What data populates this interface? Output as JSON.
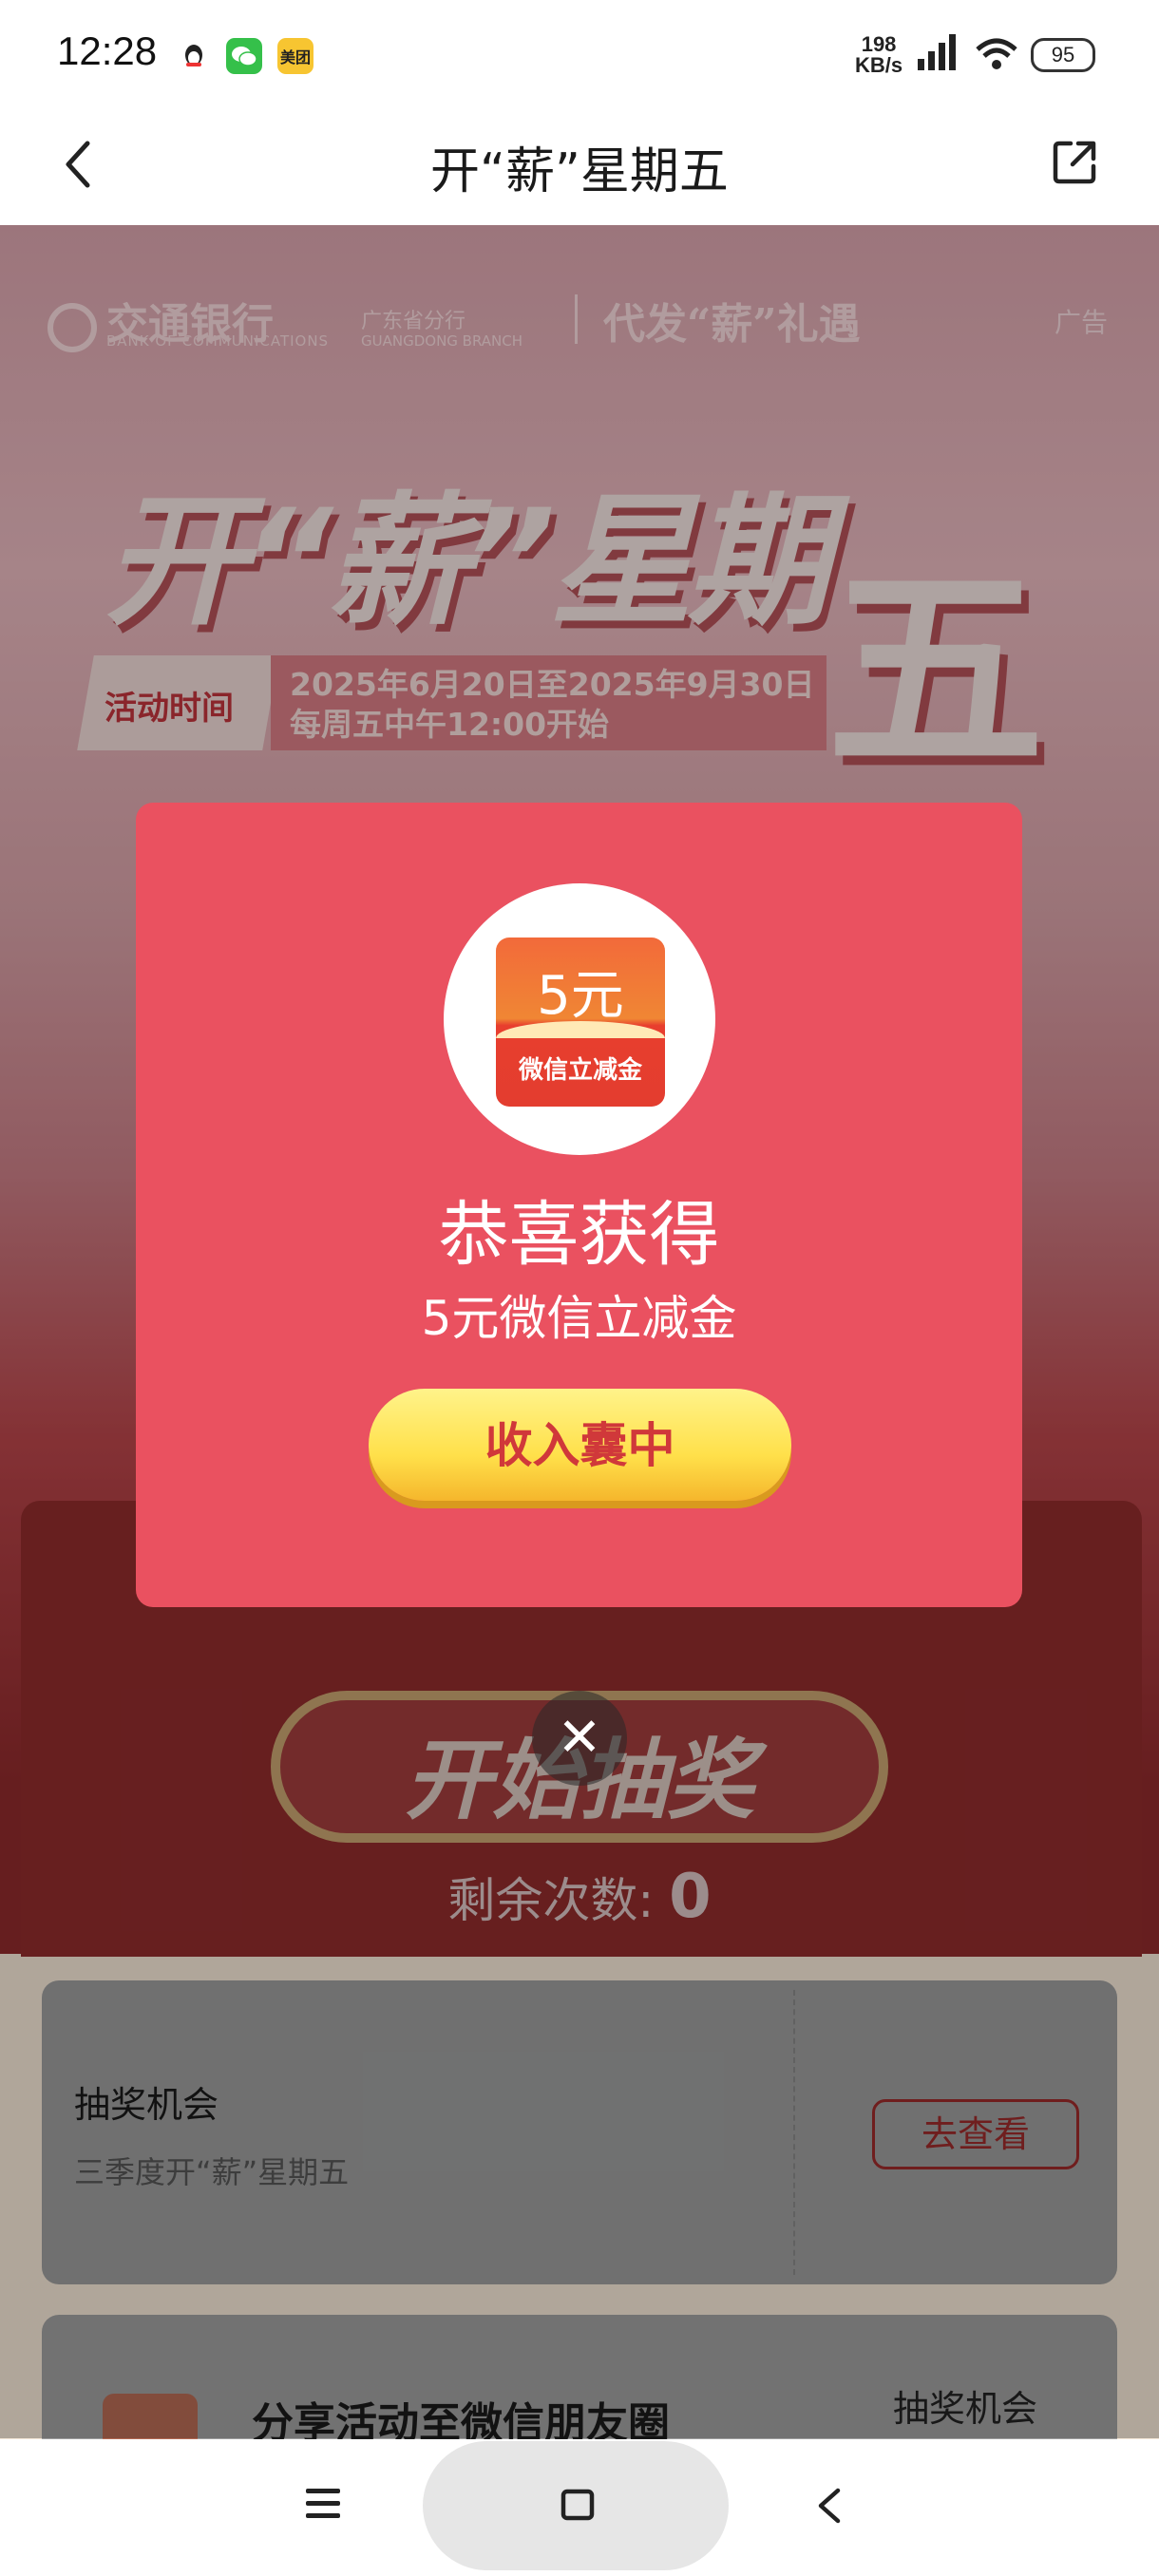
{
  "status_bar": {
    "time": "12:28",
    "net_speed_value": "198",
    "net_speed_unit": "KB/s",
    "battery": "95",
    "app_icon_meituan": "美团"
  },
  "nav": {
    "title": "开“薪”星期五"
  },
  "hero": {
    "ad_label": "广告",
    "bank_name": "交通银行",
    "bank_name_en": "BANK OF COMMUNICATIONS",
    "branch": "广东省分行",
    "branch_en": "GUANGDONG BRANCH",
    "slogan": "代发“薪”礼遇",
    "title_main": "开“薪”星期",
    "title_five": "五",
    "activity_tag": "活动时间",
    "activity_dates": "2025年6月20日至2025年9月30日",
    "activity_time": "每周五中午12:00开始",
    "start_button": "开始抽奖",
    "remaining_label": "剩余次数:",
    "remaining_count": "0"
  },
  "cards": [
    {
      "title": "抽奖机会",
      "subtitle": "三季度开“薪”星期五",
      "button": "去查看"
    },
    {
      "title": "分享活动至微信朋友圈",
      "right_label": "抽奖机会"
    }
  ],
  "modal": {
    "prize_amount": "5元",
    "prize_type": "微信立减金",
    "title": "恭喜获得",
    "subtitle": "5元微信立减金",
    "collect_button": "收入囊中"
  }
}
